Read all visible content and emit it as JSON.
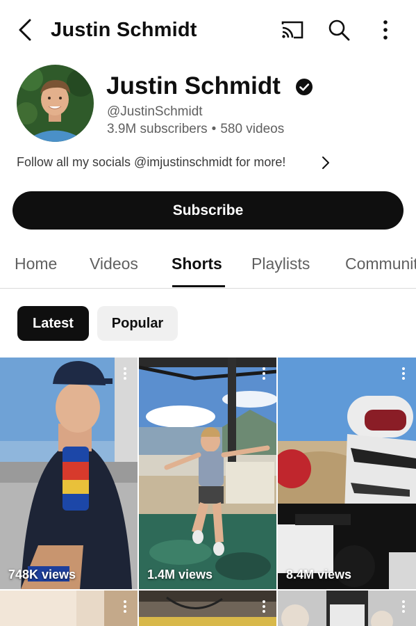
{
  "topbar": {
    "title": "Justin Schmidt",
    "icons": [
      "back-icon",
      "cast-icon",
      "search-icon",
      "more-vert-icon"
    ]
  },
  "channel": {
    "name": "Justin Schmidt",
    "handle": "@JustinSchmidt",
    "subscribers": "3.9M subscribers",
    "separator": "•",
    "videos": "580 videos",
    "bio": "Follow all my socials @imjustinschmidt for more!",
    "subscribe_label": "Subscribe"
  },
  "tabs": [
    {
      "label": "Home",
      "active": false
    },
    {
      "label": "Videos",
      "active": false
    },
    {
      "label": "Shorts",
      "active": true
    },
    {
      "label": "Playlists",
      "active": false
    },
    {
      "label": "Community",
      "active": false
    }
  ],
  "chips": {
    "latest": "Latest",
    "popular": "Popular",
    "selected": "Latest"
  },
  "shorts": [
    {
      "views": "748K views"
    },
    {
      "views": "1.4M views"
    },
    {
      "views": "8.4M views"
    },
    {
      "views": ""
    },
    {
      "views": ""
    },
    {
      "views": ""
    }
  ],
  "colors": {
    "text_primary": "#0f0f0f",
    "text_secondary": "#606060",
    "button_dark": "#0f0f0f",
    "chip_light": "#f0f0f0"
  }
}
